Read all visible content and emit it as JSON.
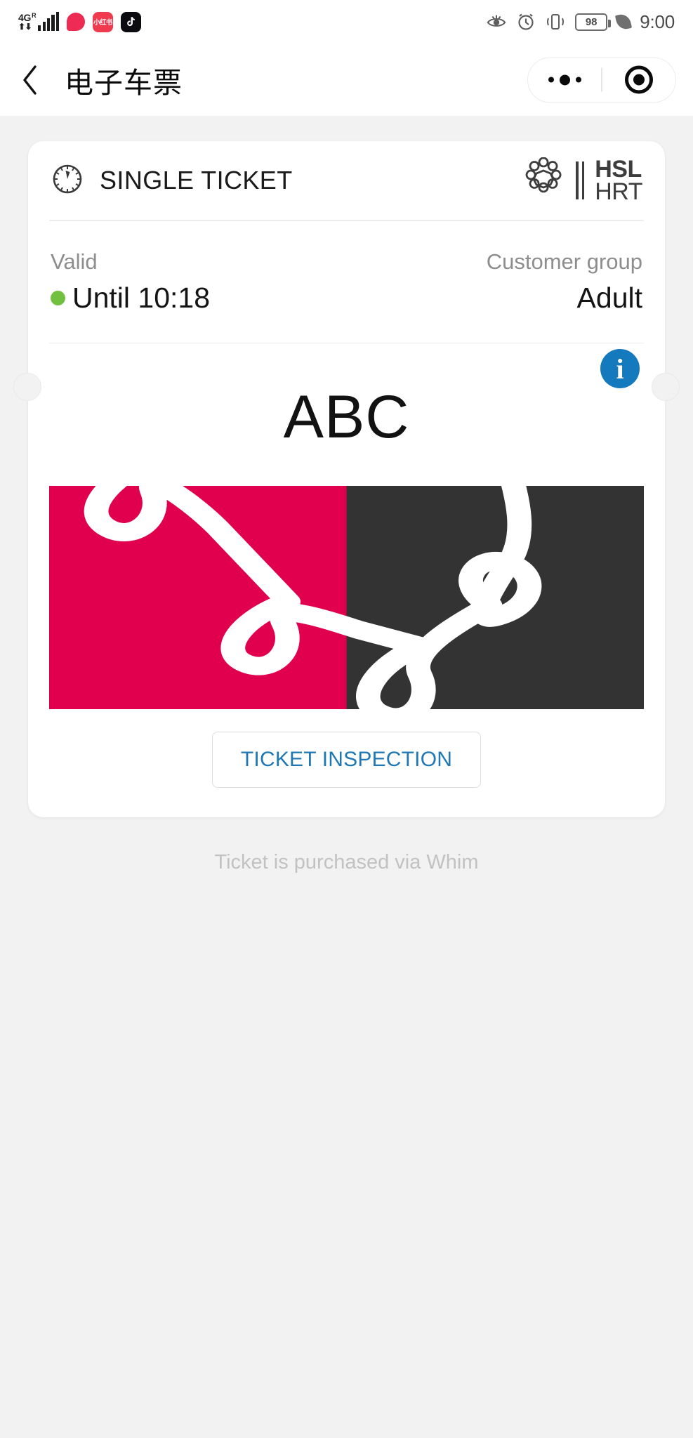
{
  "status_bar": {
    "network_type": "4G",
    "roaming": "R",
    "signal_bars": 5,
    "app_icons": [
      {
        "name": "video-app-icon",
        "label": ""
      },
      {
        "name": "xiaohongshu-icon",
        "label": "小红书"
      },
      {
        "name": "tiktok-icon",
        "label": "♪"
      }
    ],
    "icons": [
      "eye-comfort-icon",
      "alarm-icon",
      "vibrate-icon",
      "battery-icon",
      "power-saving-leaf-icon"
    ],
    "battery_level": "98",
    "time": "9:00"
  },
  "nav": {
    "back_icon": "back-chevron-icon",
    "title": "电子车票",
    "capsule": {
      "more_icon": "more-dots-icon",
      "close_icon": "close-target-icon"
    }
  },
  "ticket": {
    "type_icon": "clock-icon",
    "type_label": "SINGLE TICKET",
    "brand": {
      "symbol": "hsl-network-loop-icon",
      "line1": "HSL",
      "line2": "HRT"
    },
    "valid": {
      "label": "Valid",
      "value": "Until 10:18",
      "status_color": "#72c040"
    },
    "customer_group": {
      "label": "Customer group",
      "value": "Adult"
    },
    "info_icon": "info-icon",
    "info_glyph": "i",
    "verification_code": "ABC",
    "animation": {
      "name": "hsl-loop-animation",
      "left_color": "#e0004d",
      "right_color": "#333333",
      "stroke_color": "#ffffff"
    },
    "inspection_button": {
      "label": "TICKET INSPECTION",
      "text_color": "#1f78b4"
    }
  },
  "footer": {
    "note": "Ticket is purchased via Whim"
  }
}
